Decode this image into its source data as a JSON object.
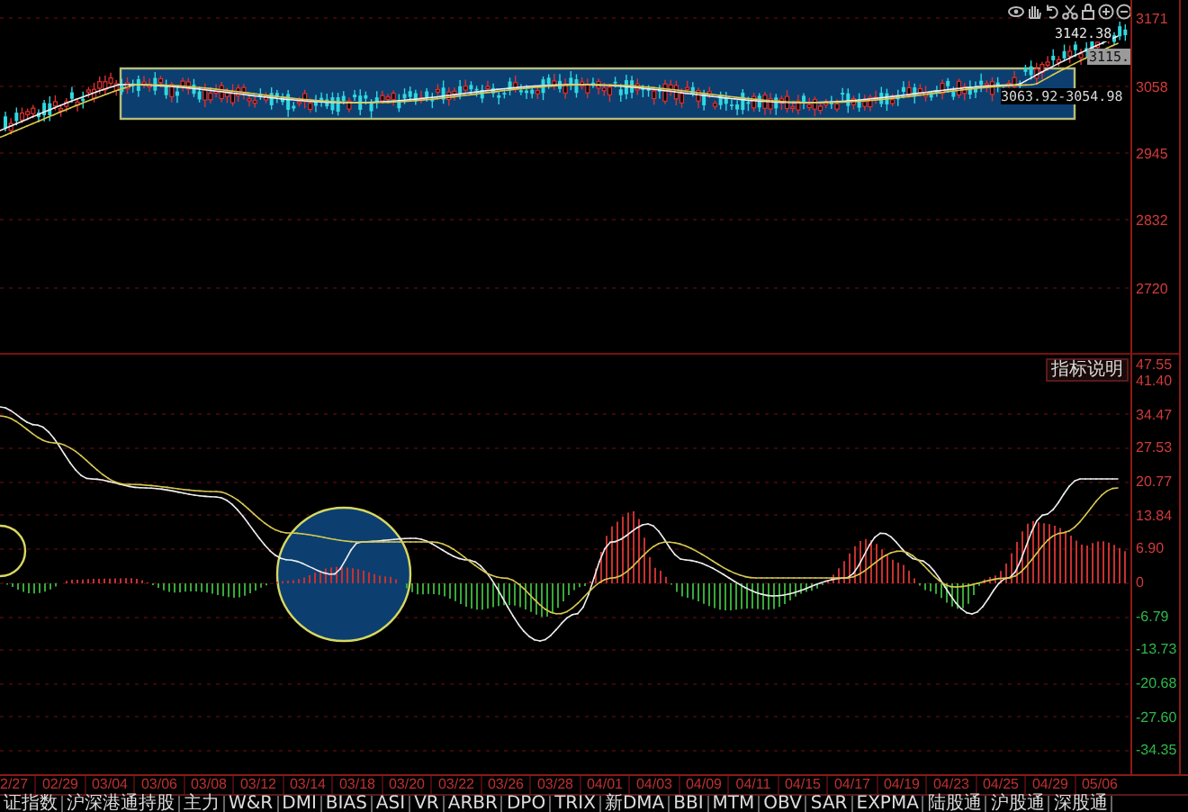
{
  "price_pane": {
    "axis_labels": [
      "3171",
      "3058",
      "2945",
      "2832",
      "2720"
    ],
    "annotations": [
      {
        "kind": "high",
        "text": "3142.38"
      },
      {
        "kind": "last",
        "text": "3115."
      },
      {
        "kind": "range",
        "text": "3063.92-3054.98"
      }
    ]
  },
  "indicator_pane": {
    "help_button": "指标说明",
    "axis_labels": [
      {
        "text": "47.55",
        "kind": "positive"
      },
      {
        "text": "41.40",
        "kind": "positive"
      },
      {
        "text": "34.47",
        "kind": "positive"
      },
      {
        "text": "27.53",
        "kind": "positive"
      },
      {
        "text": "20.77",
        "kind": "positive"
      },
      {
        "text": "13.84",
        "kind": "positive"
      },
      {
        "text": "6.90",
        "kind": "positive"
      },
      {
        "text": "0",
        "kind": "positive"
      },
      {
        "text": "-6.79",
        "kind": "negative"
      },
      {
        "text": "-13.73",
        "kind": "negative"
      },
      {
        "text": "-20.68",
        "kind": "negative"
      },
      {
        "text": "-27.60",
        "kind": "negative"
      },
      {
        "text": "-34.35",
        "kind": "negative"
      }
    ]
  },
  "dates": [
    "2/27",
    "02/29",
    "03/04",
    "03/06",
    "03/08",
    "03/12",
    "03/14",
    "03/18",
    "03/20",
    "03/22",
    "03/26",
    "03/28",
    "04/01",
    "04/03",
    "04/09",
    "04/11",
    "04/15",
    "04/17",
    "04/19",
    "04/23",
    "04/25",
    "04/29",
    "05/06"
  ],
  "tabs": [
    {
      "label": "证指数",
      "selected": false
    },
    {
      "label": "沪深港通持股",
      "selected": false
    },
    {
      "label": "主力",
      "selected": false
    },
    {
      "label": "W&R",
      "selected": false
    },
    {
      "label": "DMI",
      "selected": false
    },
    {
      "label": "BIAS",
      "selected": false
    },
    {
      "label": "ASI",
      "selected": false
    },
    {
      "label": "VR",
      "selected": false
    },
    {
      "label": "ARBR",
      "selected": false
    },
    {
      "label": "DPO",
      "selected": false
    },
    {
      "label": "TRIX",
      "selected": false
    },
    {
      "label": "新DMA",
      "selected": false
    },
    {
      "label": "BBI",
      "selected": false
    },
    {
      "label": "MTM",
      "selected": false
    },
    {
      "label": "OBV",
      "selected": false
    },
    {
      "label": "SAR",
      "selected": false
    },
    {
      "label": "EXPMA",
      "selected": false
    },
    {
      "label": "陆股通",
      "selected": false
    },
    {
      "label": "沪股通",
      "selected": false
    },
    {
      "label": "深股通",
      "selected": false
    }
  ]
}
